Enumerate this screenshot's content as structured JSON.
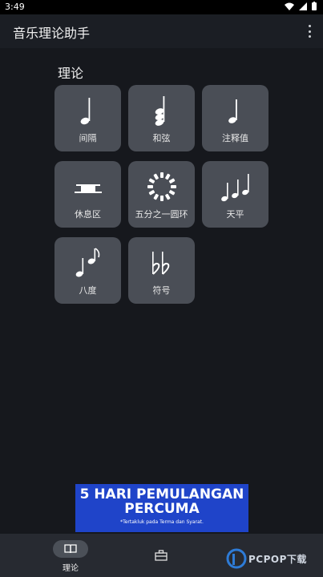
{
  "status_bar": {
    "time": "3:49"
  },
  "app_bar": {
    "title": "音乐理论助手"
  },
  "section": {
    "title": "理论"
  },
  "tiles": [
    {
      "label": "间隔",
      "icon": "quarter-note-icon"
    },
    {
      "label": "和弦",
      "icon": "chord-icon"
    },
    {
      "label": "注释值",
      "icon": "note-value-icon"
    },
    {
      "label": "休息区",
      "icon": "rest-icon"
    },
    {
      "label": "五分之一圆环",
      "icon": "circle-of-fifths-icon"
    },
    {
      "label": "天平",
      "icon": "scales-icon"
    },
    {
      "label": "八度",
      "icon": "octave-icon"
    },
    {
      "label": "符号",
      "icon": "double-flat-icon"
    }
  ],
  "ad": {
    "line1": "5 HARI PEMULANGAN",
    "line2": "PERCUMA",
    "line3": "*Tertakluk pada Terma dan Syarat."
  },
  "bottom_nav": {
    "items": [
      {
        "label": "理论",
        "icon": "book-icon"
      },
      {
        "label": "",
        "icon": "toolbox-icon"
      }
    ]
  },
  "watermark": {
    "text": "PCPOP下载"
  },
  "colors": {
    "background": "#16181d",
    "tile": "#4a4e56",
    "nav": "#272a31",
    "ad": "#1f44c9"
  }
}
